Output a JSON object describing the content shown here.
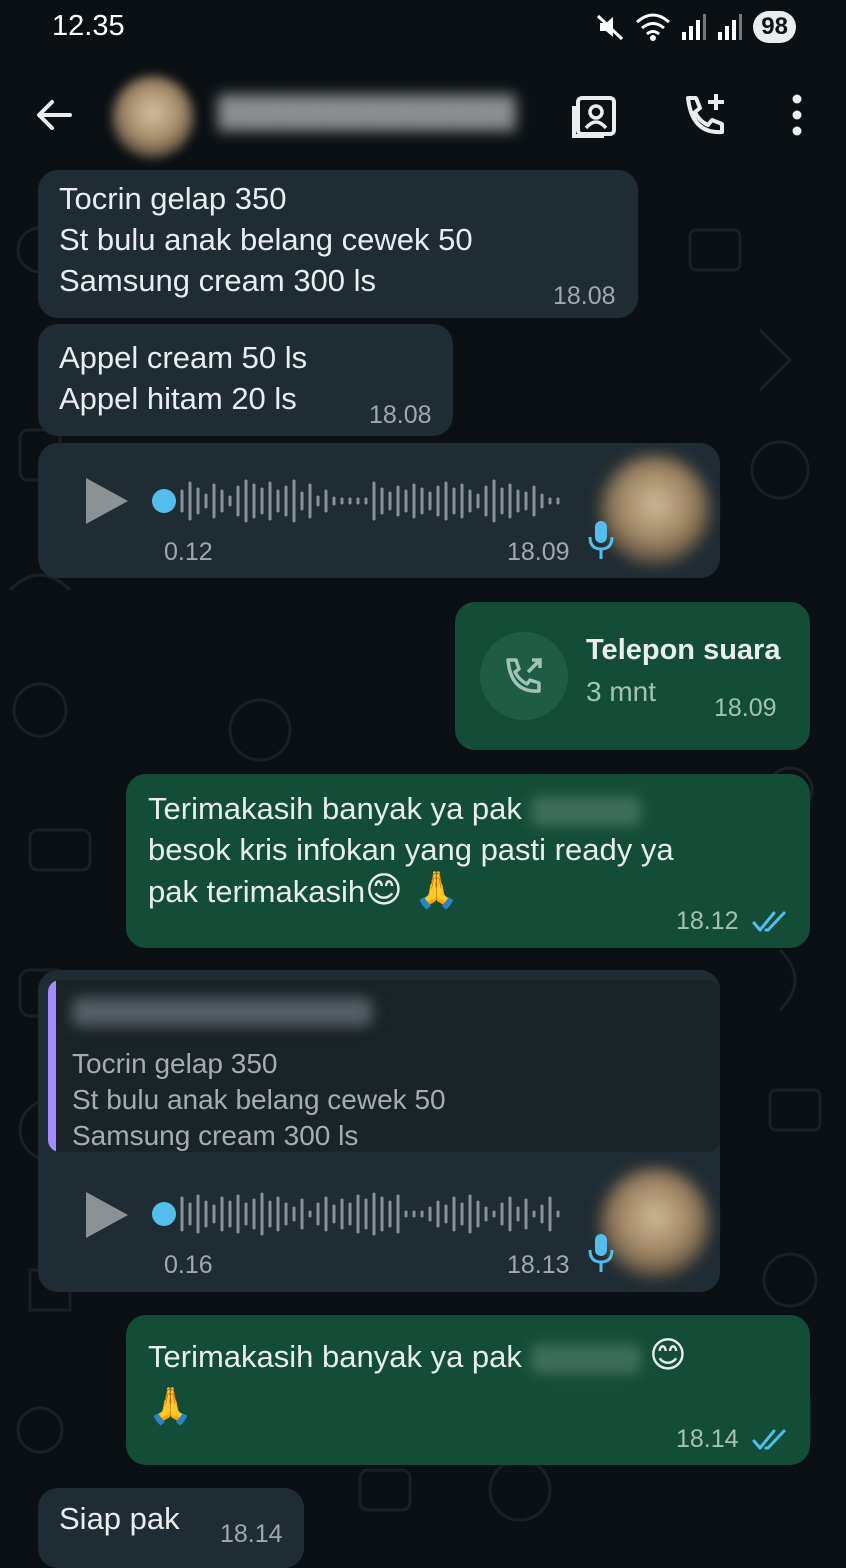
{
  "status_bar": {
    "time": "12.35",
    "battery": "98"
  },
  "header": {
    "icons": [
      "back-arrow-icon",
      "contact-avatar",
      "video-call-icon",
      "add-call-icon",
      "more-vert-icon"
    ]
  },
  "messages": [
    {
      "type": "text",
      "direction": "in",
      "text": "Tocrin gelap 350\nSt bulu anak belang cewek 50\nSamsung cream 300 ls",
      "time": "18.08"
    },
    {
      "type": "text",
      "direction": "in",
      "text": "Appel cream 50 ls\nAppel hitam 20 ls",
      "time": "18.08"
    },
    {
      "type": "voice",
      "direction": "in",
      "duration": "0.12",
      "time": "18.09"
    },
    {
      "type": "call",
      "direction": "out",
      "title": "Telepon suara",
      "subtitle": "3 mnt",
      "time": "18.09"
    },
    {
      "type": "text",
      "direction": "out",
      "line1": "Terimakasih banyak ya pak",
      "line2": "besok kris infokan yang pasti ready ya",
      "line3": "pak terimakasih",
      "emoji": "😊 🙏",
      "time": "18.12",
      "status": "read"
    },
    {
      "type": "voice",
      "direction": "in",
      "quoted_text": "Tocrin gelap 350\nSt bulu anak belang cewek 50\nSamsung cream 300 ls",
      "duration": "0.16",
      "time": "18.13"
    },
    {
      "type": "text",
      "direction": "out",
      "line1": "Terimakasih banyak ya pak",
      "emoji1": "😊",
      "emoji2": "🙏",
      "time": "18.14",
      "status": "read"
    },
    {
      "type": "text",
      "direction": "in",
      "text": "Siap pak",
      "time": "18.14"
    }
  ],
  "colors": {
    "background": "#0b1014",
    "incoming_bubble": "#202c33",
    "outgoing_bubble": "#144d37",
    "accent_blue": "#53bdeb",
    "quote_bar": "#a78bfa"
  }
}
